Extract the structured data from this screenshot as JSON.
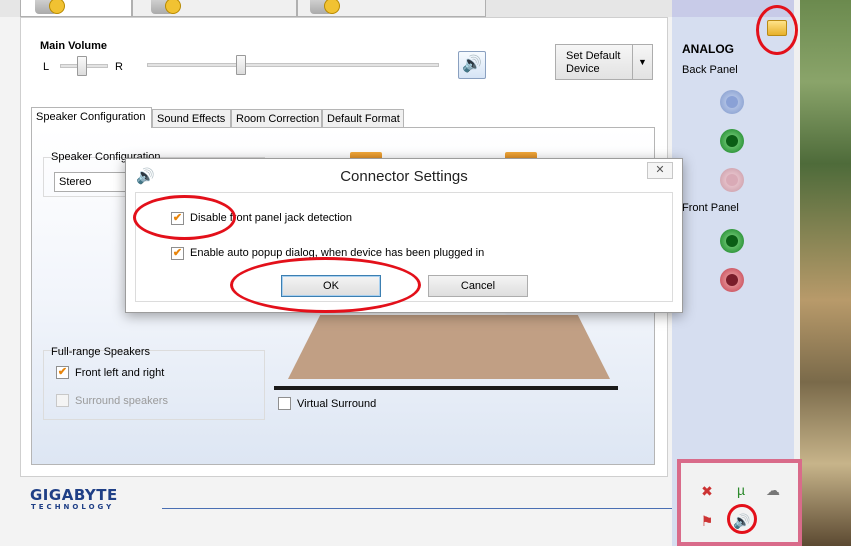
{
  "colors": {
    "annotation": "#e3101a",
    "brand": "#1f3f86",
    "checkmark": "#e8850c"
  },
  "main_volume": {
    "title": "Main Volume",
    "left_label": "L",
    "right_label": "R",
    "speaker_icon": "speaker-volume-icon"
  },
  "set_default": {
    "label": "Set Default Device"
  },
  "tabs": [
    {
      "label": "Speaker Configuration"
    },
    {
      "label": "Sound Effects"
    },
    {
      "label": "Room Correction"
    },
    {
      "label": "Default Format"
    }
  ],
  "speaker_config": {
    "group_title": "Speaker Configuration",
    "selected": "Stereo"
  },
  "full_range": {
    "title": "Full-range Speakers",
    "front": {
      "label": "Front left and right",
      "checked": true
    },
    "surround": {
      "label": "Surround speakers",
      "checked": false,
      "disabled": true
    }
  },
  "virtual_surround": {
    "label": "Virtual Surround",
    "checked": false
  },
  "branding": {
    "name": "GIGABYTE",
    "sub": "TECHNOLOGY"
  },
  "analog": {
    "title": "ANALOG",
    "back_panel": "Back Panel",
    "front_panel": "Front Panel"
  },
  "dialog": {
    "title": "Connector Settings",
    "close_label": "✕",
    "options": [
      {
        "label": "Disable front panel jack detection",
        "checked": true
      },
      {
        "label": "Enable auto popup dialog, when device has been plugged in",
        "checked": true
      }
    ],
    "ok_label": "OK",
    "cancel_label": "Cancel"
  },
  "tray_icons": [
    "network-warning-icon",
    "utorrent-icon",
    "cloud-warning-icon",
    "action-center-flag-icon",
    "speaker-volume-icon"
  ]
}
